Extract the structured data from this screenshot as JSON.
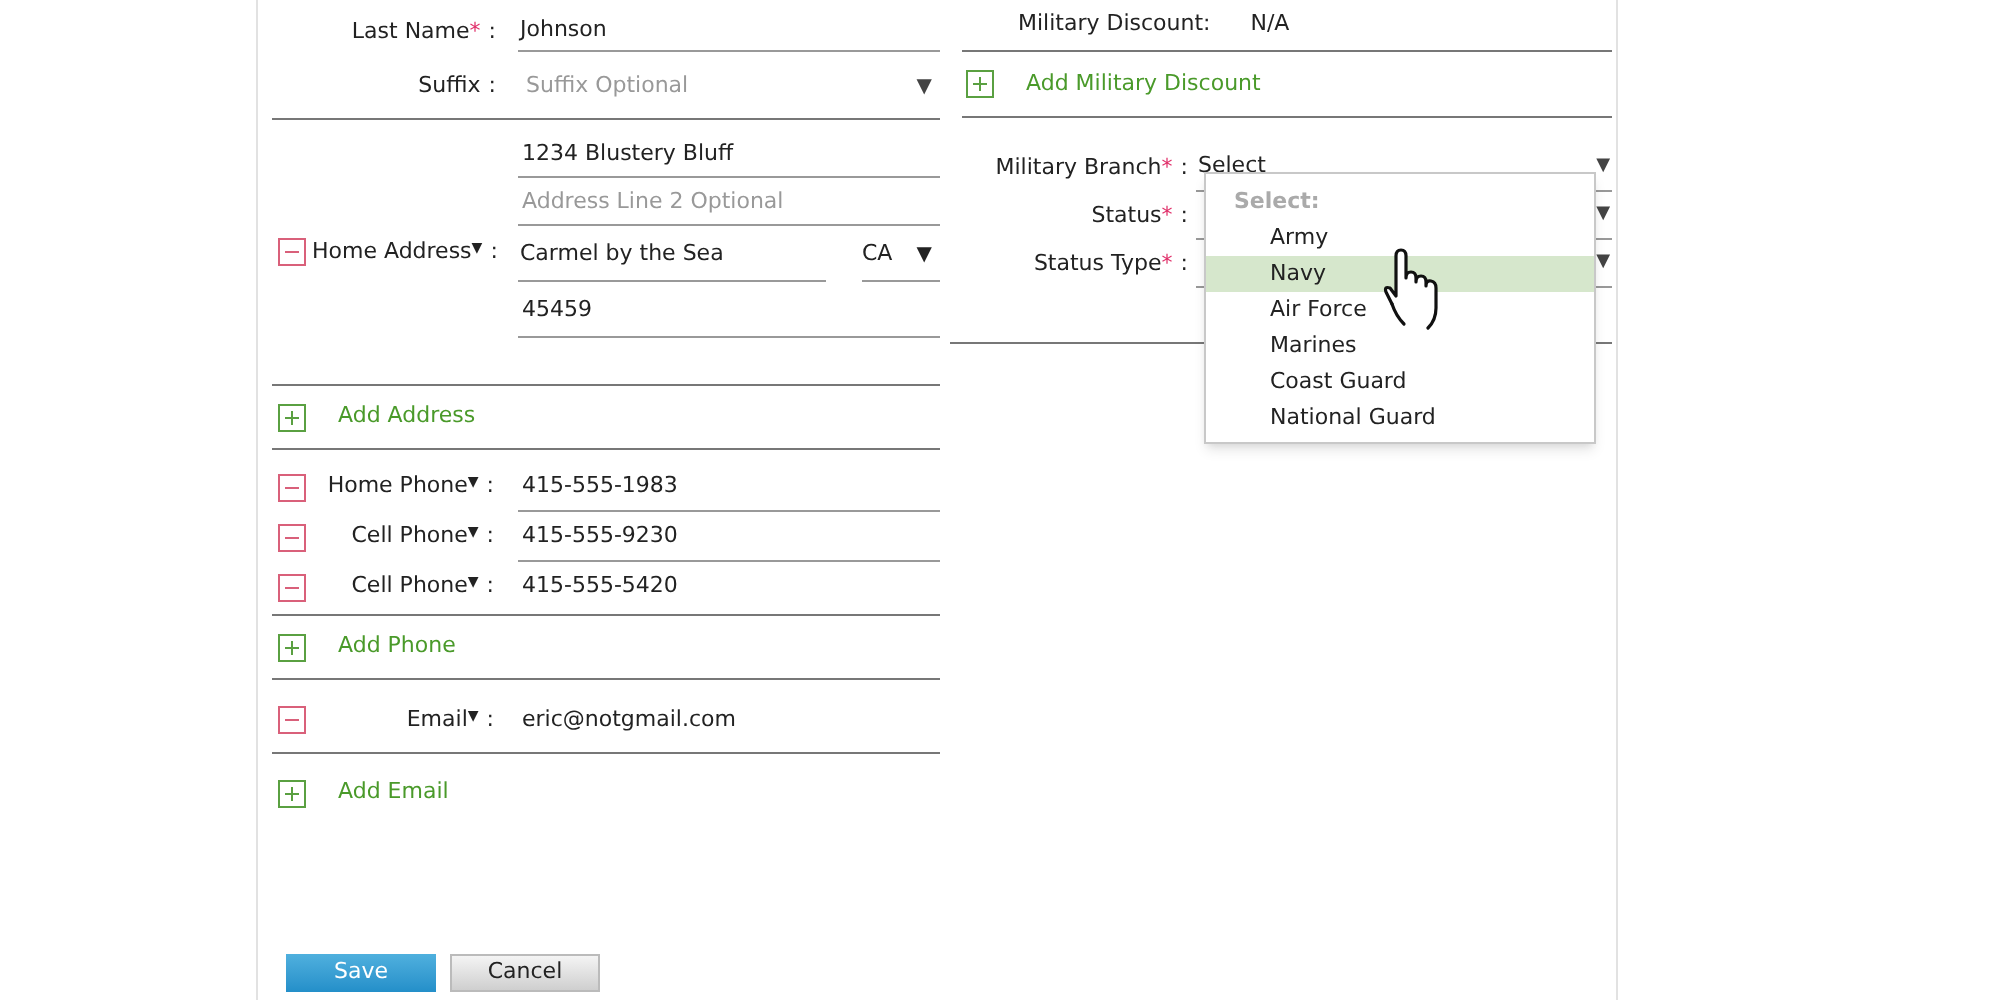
{
  "name_fields": [
    {
      "label": "Last Name",
      "required_mark": "*",
      "colon": ":",
      "value": "Johnson",
      "kind": "text"
    },
    {
      "label": "Suffix",
      "colon": ":",
      "placeholder": "Suffix Optional",
      "kind": "select",
      "select_caret": "▼"
    }
  ],
  "addresses": [
    {
      "label": "Home Address",
      "caret": "▼",
      "colon": ":",
      "line1": "1234 Blustery Bluff",
      "line2_placeholder": "Address Line 2 Optional",
      "city": "Carmel by the Sea",
      "state": "CA",
      "state_caret": "▼",
      "zip": "45459"
    }
  ],
  "add_address": "Add Address",
  "phones": [
    {
      "label": "Home Phone",
      "caret": "▼",
      "colon": ":",
      "value": "415-555-1983"
    },
    {
      "label": "Cell Phone",
      "caret": "▼",
      "colon": ":",
      "value": "415-555-9230"
    },
    {
      "label": "Cell Phone",
      "caret": "▼",
      "colon": ":",
      "value": "415-555-5420"
    }
  ],
  "add_phone": "Add Phone",
  "emails": [
    {
      "label": "Email",
      "caret": "▼",
      "colon": ":",
      "value": "eric@notgmail.com"
    }
  ],
  "add_email": "Add Email",
  "military_discount": {
    "label": "Military Discount:",
    "value": "N/A"
  },
  "add_military_discount": "Add Military Discount",
  "military_fields": [
    {
      "label": "Military Branch",
      "required_mark": "*",
      "colon": ":",
      "value": "Select",
      "select_caret": "▼"
    },
    {
      "label": "Status",
      "required_mark": "*",
      "colon": ":",
      "select_caret": "▼"
    },
    {
      "label": "Status Type",
      "required_mark": "*",
      "colon": ":",
      "select_caret": "▼"
    }
  ],
  "dropdown": {
    "header": "Select:",
    "options": [
      {
        "label": "Army",
        "selected": false
      },
      {
        "label": "Navy",
        "selected": true
      },
      {
        "label": "Air Force",
        "selected": false
      },
      {
        "label": "Marines",
        "selected": false
      },
      {
        "label": "Coast Guard",
        "selected": false
      },
      {
        "label": "National Guard",
        "selected": false
      }
    ]
  },
  "buttons": [
    {
      "label": "Save",
      "kind": "primary"
    },
    {
      "label": "Cancel",
      "kind": "secondary"
    }
  ]
}
